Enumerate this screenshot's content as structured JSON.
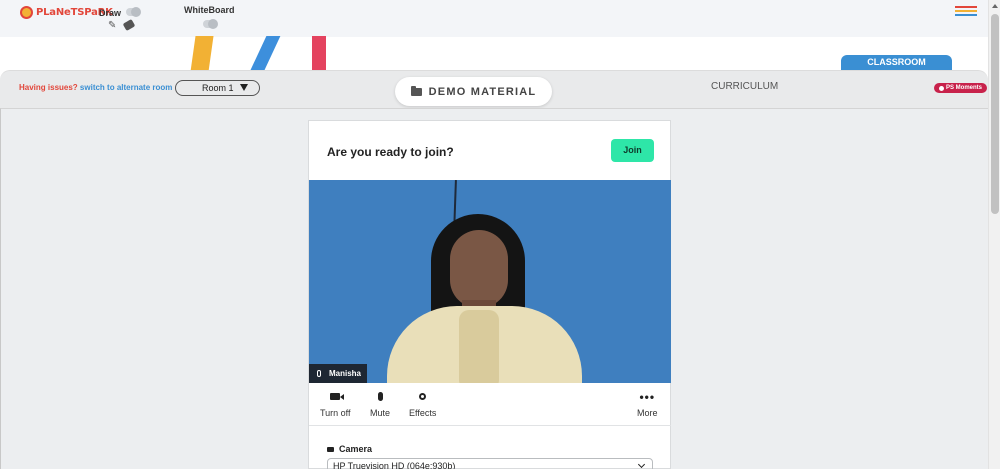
{
  "header": {
    "logo_text": "PLaNeTSPaRK",
    "draw_label": "Draw",
    "whiteboard_label": "WhiteBoard",
    "menu_colors": [
      "#e2463a",
      "#f2b134",
      "#3a8fd3"
    ]
  },
  "tabs": {
    "classroom": "CLASSROOM",
    "issues_prefix": "Having issues?",
    "issues_link": "switch to alternate room",
    "room_selected": "Room 1",
    "demo_material": "DEMO MATERIAL",
    "curriculum": "CURRICULUM",
    "ps_moments": "PS Moments"
  },
  "prejoin": {
    "title": "Are you ready to join?",
    "join_label": "Join",
    "participant_name": "Manisha",
    "controls": [
      {
        "label": "Turn off",
        "icon": "video-camera-icon"
      },
      {
        "label": "Mute",
        "icon": "microphone-icon"
      },
      {
        "label": "Effects",
        "icon": "effects-icon"
      },
      {
        "label": "More",
        "icon": "more-icon"
      }
    ],
    "camera_label": "Camera",
    "camera_value": "HP Truevision HD (064e:930b)"
  },
  "colors": {
    "brand_red": "#e2463a",
    "classroom_blue": "#3a8fd3",
    "join_green": "#2ee6a8",
    "ps_moments": "#c8224b"
  }
}
